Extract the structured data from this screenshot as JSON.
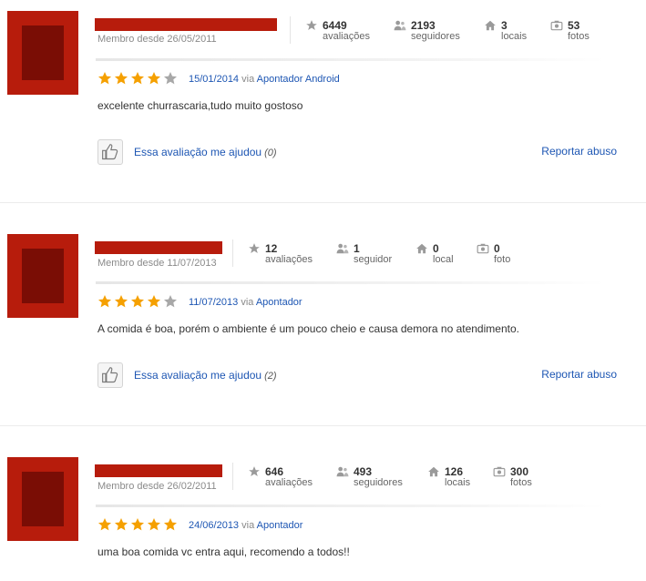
{
  "reviews": [
    {
      "member_since": "Membro desde 26/05/2011",
      "stats": [
        {
          "icon": "star-icon",
          "value": "6449",
          "label": "avaliações"
        },
        {
          "icon": "followers-icon",
          "value": "2193",
          "label": "seguidores"
        },
        {
          "icon": "home-icon",
          "value": "3",
          "label": "locais"
        },
        {
          "icon": "camera-icon",
          "value": "53",
          "label": "fotos"
        }
      ],
      "rating": 4,
      "date": "15/01/2014",
      "via": "via",
      "source": "Apontador Android",
      "text": "excelente churrascaria,tudo muito gostoso",
      "helped_label": "Essa avaliação me ajudou",
      "helped_count": "(0)",
      "report_label": "Reportar abuso"
    },
    {
      "member_since": "Membro desde 11/07/2013",
      "stats": [
        {
          "icon": "star-icon",
          "value": "12",
          "label": "avaliações"
        },
        {
          "icon": "followers-icon",
          "value": "1",
          "label": "seguidor"
        },
        {
          "icon": "home-icon",
          "value": "0",
          "label": "local"
        },
        {
          "icon": "camera-icon",
          "value": "0",
          "label": "foto"
        }
      ],
      "rating": 4,
      "date": "11/07/2013",
      "via": "via",
      "source": "Apontador",
      "text": "A comida é boa, porém o ambiente é um pouco cheio e causa demora no atendimento.",
      "helped_label": "Essa avaliação me ajudou",
      "helped_count": "(2)",
      "report_label": "Reportar abuso"
    },
    {
      "member_since": "Membro desde 26/02/2011",
      "stats": [
        {
          "icon": "star-icon",
          "value": "646",
          "label": "avaliações"
        },
        {
          "icon": "followers-icon",
          "value": "493",
          "label": "seguidores"
        },
        {
          "icon": "home-icon",
          "value": "126",
          "label": "locais"
        },
        {
          "icon": "camera-icon",
          "value": "300",
          "label": "fotos"
        }
      ],
      "rating": 5,
      "date": "24/06/2013",
      "via": "via",
      "source": "Apontador",
      "text": "uma boa comida vc entra aqui, recomendo a todos!!"
    }
  ],
  "colors": {
    "avatar_red": "#b71c0c",
    "avatar_dark": "#7a0d05",
    "link_blue": "#1d56b3",
    "star_gold": "#f5a000",
    "star_grey": "#a8a8a8"
  }
}
